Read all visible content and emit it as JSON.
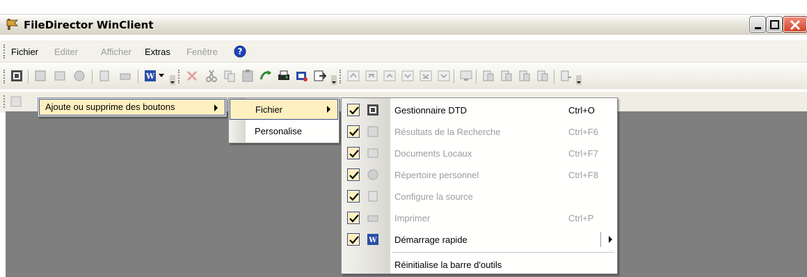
{
  "window": {
    "title": "FileDirector WinClient"
  },
  "menubar": {
    "items": [
      {
        "label": "Fichier",
        "enabled": true
      },
      {
        "label": "Editer",
        "enabled": false
      },
      {
        "label": "Afficher",
        "enabled": false
      },
      {
        "label": "Extras",
        "enabled": true
      },
      {
        "label": "Fenêtre",
        "enabled": false
      }
    ]
  },
  "menu_level1": {
    "label": "Ajoute ou supprime des boutons"
  },
  "menu_level2": {
    "items": [
      {
        "label": "Fichier"
      },
      {
        "label": "Personalise"
      }
    ]
  },
  "menu_level3": {
    "items": [
      {
        "label": "Gestionnaire DTD",
        "shortcut": "Ctrl+O",
        "checked": true,
        "enabled": true,
        "icon": "dtd-manager-icon"
      },
      {
        "label": "Résultats de la Recherche",
        "shortcut": "Ctrl+F6",
        "checked": true,
        "enabled": false,
        "icon": "search-results-icon"
      },
      {
        "label": "Documents Locaux",
        "shortcut": "Ctrl+F7",
        "checked": true,
        "enabled": false,
        "icon": "local-documents-icon"
      },
      {
        "label": "Répertoire personnel",
        "shortcut": "Ctrl+F8",
        "checked": true,
        "enabled": false,
        "icon": "personal-directory-icon"
      },
      {
        "label": "Configure la source",
        "shortcut": "",
        "checked": true,
        "enabled": false,
        "icon": "configure-source-icon"
      },
      {
        "label": "Imprimer",
        "shortcut": "Ctrl+P",
        "checked": true,
        "enabled": false,
        "icon": "print-icon"
      },
      {
        "label": "Démarrage rapide",
        "shortcut": "",
        "checked": true,
        "enabled": true,
        "icon": "quick-start-icon"
      }
    ],
    "reset_label": "Réinitialise la barre d'outils"
  },
  "colors": {
    "highlight": "#fff0c0",
    "highlight_border": "#3b4c8a",
    "client_area": "#7f7f7f"
  }
}
